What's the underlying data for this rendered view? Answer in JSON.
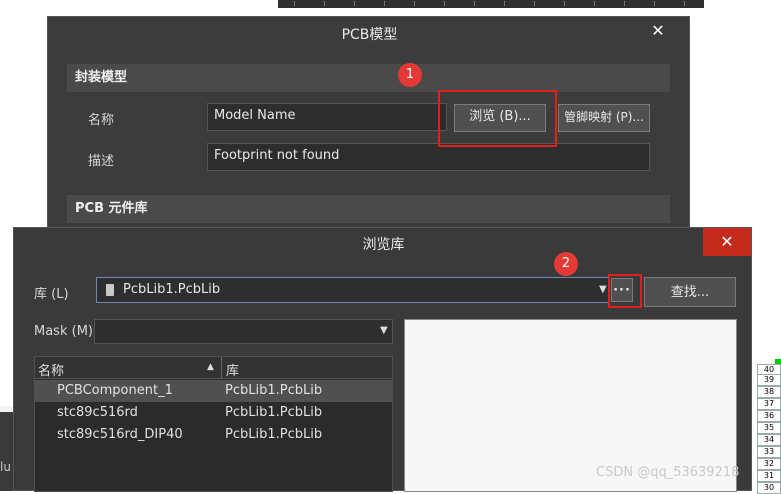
{
  "pcb_model_dialog": {
    "title": "PCB模型",
    "section_footprint": "封装模型",
    "name_label": "名称",
    "name_value": "Model Name",
    "browse_button": "浏览 (B)...",
    "pin_map_button": "管脚映射 (P)...",
    "desc_label": "描述",
    "desc_value": "Footprint not found",
    "section_library": "PCB 元件库",
    "close_glyph": "✕"
  },
  "browse_dialog": {
    "title": "浏览库",
    "library_label": "库 (L)",
    "library_value": "PcbLib1.PcbLib",
    "more_button": "···",
    "find_button": "查找...",
    "mask_label": "Mask (M)",
    "mask_value": "",
    "columns": [
      "名称",
      "库"
    ],
    "rows": [
      {
        "name": "PCBComponent_1",
        "library": "PcbLib1.PcbLib",
        "selected": true
      },
      {
        "name": "stc89c516rd",
        "library": "PcbLib1.PcbLib",
        "selected": false
      },
      {
        "name": "stc89c516rd_DIP40",
        "library": "PcbLib1.PcbLib",
        "selected": false
      }
    ],
    "close_glyph": "✕"
  },
  "annotations": {
    "badge1": "1",
    "badge2": "2"
  },
  "background": {
    "partial_text": "lu",
    "pin_numbers": [
      "40",
      "39",
      "38",
      "37",
      "36",
      "35",
      "34",
      "33",
      "32",
      "31",
      "30"
    ]
  },
  "watermark": "CSDN @qq_53639218",
  "colors": {
    "accent_red": "#e02020",
    "close_red": "#c42b1c",
    "dialog_bg": "#3c3c3c"
  }
}
